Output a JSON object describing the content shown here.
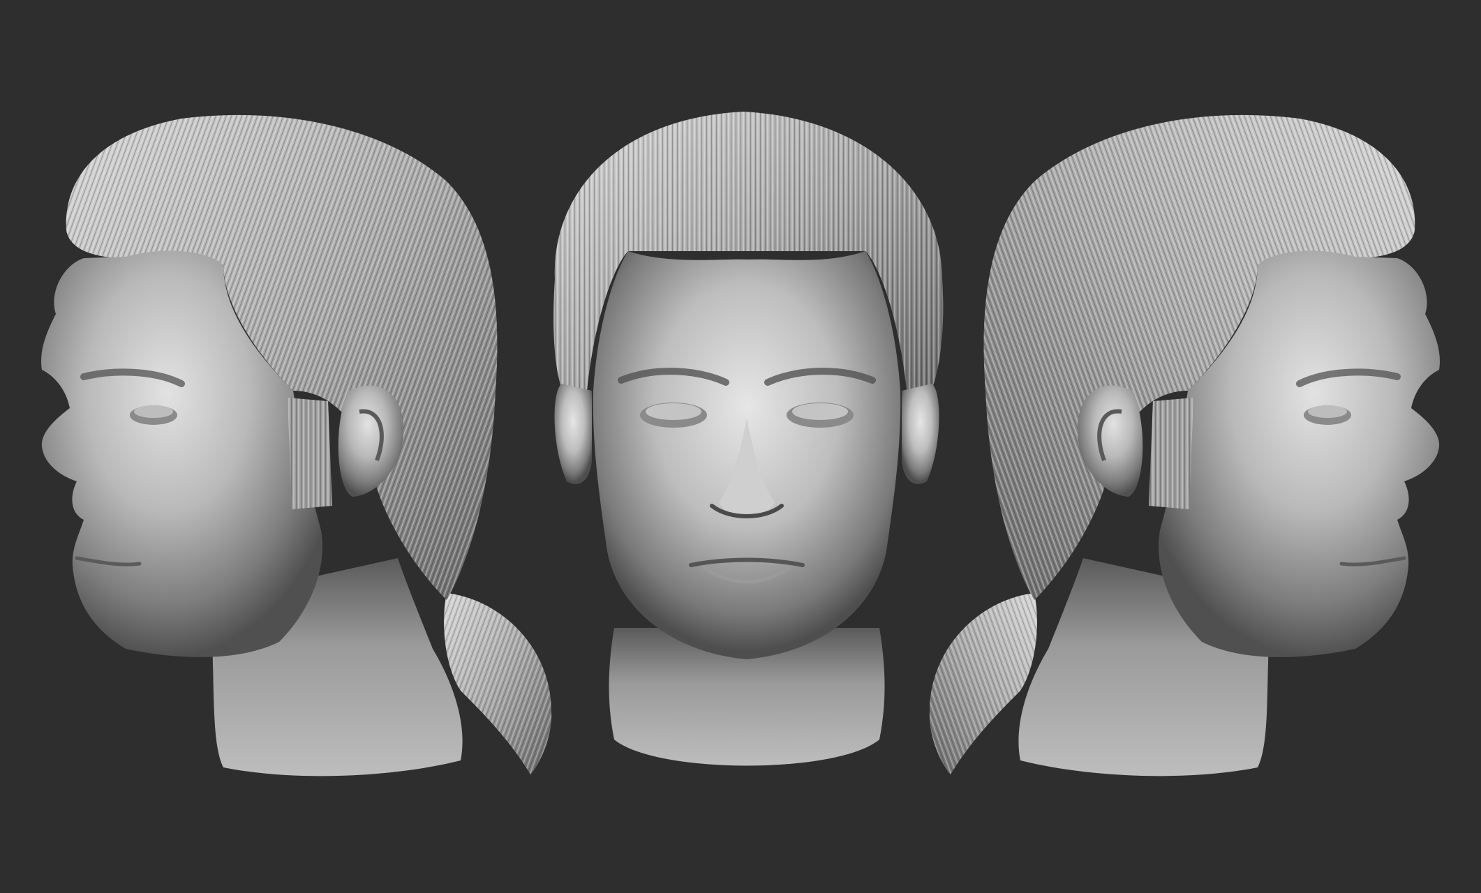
{
  "scene": {
    "background_color": "#2e2e2e",
    "material_light": "#d8d8d8",
    "material_mid": "#9a9a9a",
    "material_dark": "#4a4a4a",
    "hair_light": "#cfcfcf",
    "hair_dark": "#6e6e6e",
    "views": [
      {
        "view": "left-three-quarter",
        "subject": "male-head-sculpt"
      },
      {
        "view": "front",
        "subject": "male-head-sculpt"
      },
      {
        "view": "right-three-quarter",
        "subject": "male-head-sculpt"
      }
    ]
  }
}
